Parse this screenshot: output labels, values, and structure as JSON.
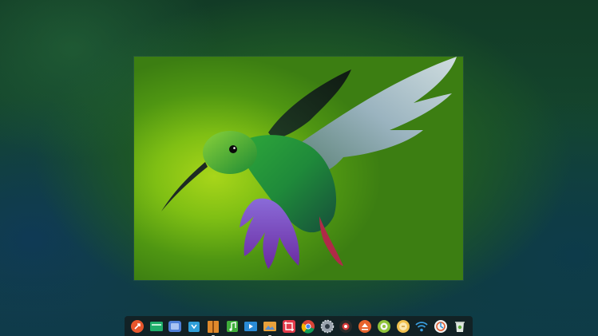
{
  "desktop": {
    "wallpaper": "blurred-green-hummingbird-wallpaper",
    "viewer": {
      "image": "hummingbird-image",
      "bg_accent": "#8cc616"
    }
  },
  "dock": {
    "items": [
      {
        "name": "launcher-icon",
        "color": "#e8562c"
      },
      {
        "name": "file-manager-icon",
        "color": "#1fae6b"
      },
      {
        "name": "multitasking-icon",
        "color": "#4f7fd8"
      },
      {
        "name": "app-store-icon",
        "color": "#2f9fd8"
      },
      {
        "name": "archive-manager-icon",
        "color": "#e08a2c"
      },
      {
        "name": "music-icon",
        "color": "#3fae3a"
      },
      {
        "name": "video-icon",
        "color": "#2a8bd6"
      },
      {
        "name": "image-viewer-icon",
        "color": "#e9a13b"
      },
      {
        "name": "screenshot-icon",
        "color": "#e23a4a"
      },
      {
        "name": "chrome-icon",
        "color": "#4285f4"
      },
      {
        "name": "settings-icon",
        "color": "#9aa3ad"
      },
      {
        "name": "screen-recorder-icon",
        "color": "#d63a3a"
      },
      {
        "name": "eject-icon",
        "color": "#e8632c"
      },
      {
        "name": "media-player-icon",
        "color": "#8fc43a"
      },
      {
        "name": "notes-icon",
        "color": "#f2c14e"
      },
      {
        "name": "wifi-icon",
        "color": "#3a9fe0"
      },
      {
        "name": "deepin-store-icon",
        "color": "#f0f0f0"
      },
      {
        "name": "trash-icon",
        "color": "#dfe6e0"
      }
    ]
  }
}
